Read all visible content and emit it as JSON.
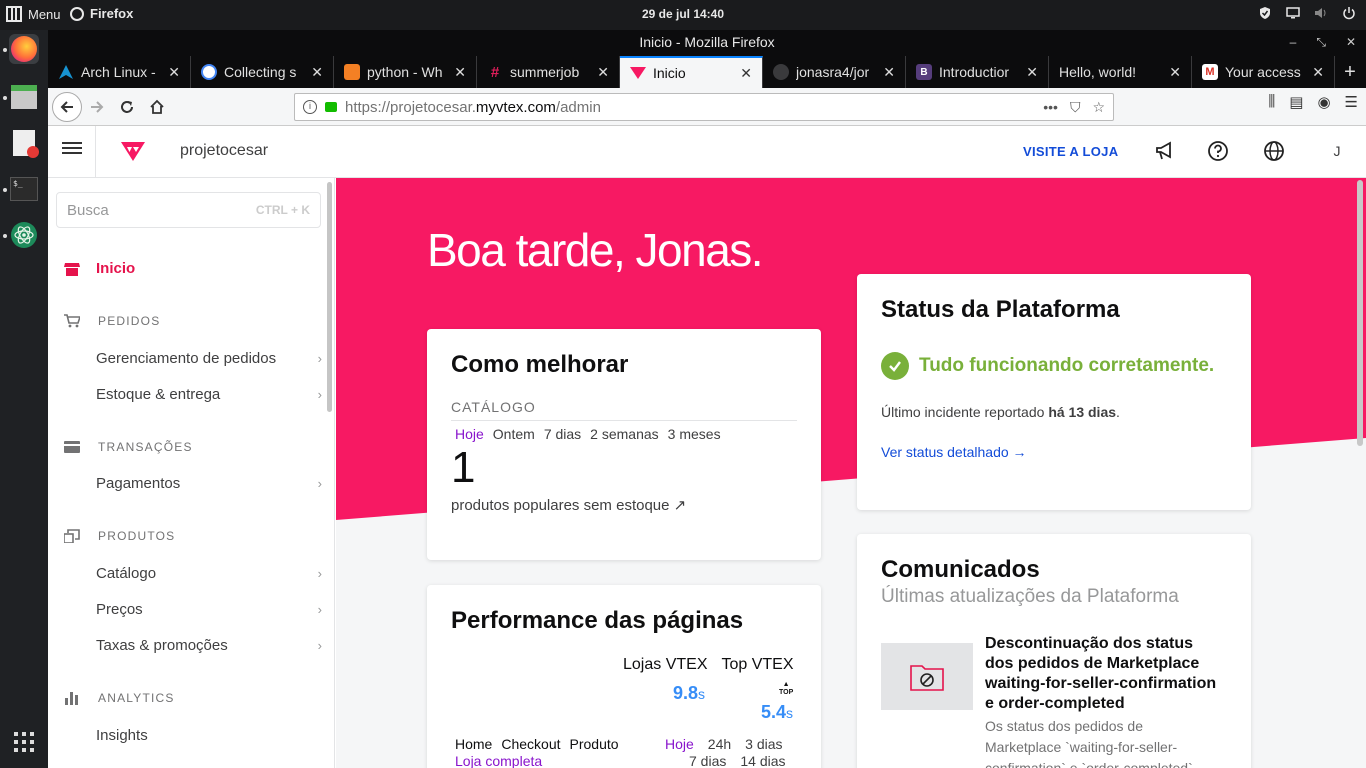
{
  "desktop": {
    "menu_label": "Menu",
    "app_name": "Firefox",
    "clock": "29 de jul  14:40"
  },
  "browser": {
    "window_title": "Inicio - Mozilla Firefox",
    "tabs": [
      {
        "label": "Arch Linux -",
        "favicon": "arch-icon",
        "color": "#1793d1"
      },
      {
        "label": "Collecting s",
        "favicon": "google-icon",
        "color": "#ffffff"
      },
      {
        "label": "python - Wh",
        "favicon": "stackoverflow-icon",
        "color": "#f48024"
      },
      {
        "label": "summerjob",
        "favicon": "slack-icon",
        "color": "#611f69"
      },
      {
        "label": "Inicio",
        "favicon": "vtex-icon",
        "color": "#f71963",
        "active": true
      },
      {
        "label": "jonasra4/jor",
        "favicon": "github-icon",
        "color": "#24292e"
      },
      {
        "label": "Introductior",
        "favicon": "bootstrap-icon",
        "color": "#563d7c"
      },
      {
        "label": "Hello, world!",
        "favicon": "none",
        "color": ""
      },
      {
        "label": "Your access",
        "favicon": "gmail-icon",
        "color": "#d93025"
      }
    ],
    "url_prefix": "https://projetocesar.",
    "url_host": "myvtex.com",
    "url_path": "/admin"
  },
  "admin": {
    "account_name": "projetocesar",
    "visit_store_label": "VISITE A LOJA",
    "avatar_initial": "J",
    "brand_color": "#f71963"
  },
  "sidebar": {
    "search_placeholder": "Busca",
    "search_shortcut": "CTRL + K",
    "home_label": "Inicio",
    "sections": [
      {
        "title": "PEDIDOS",
        "items": [
          "Gerenciamento de pedidos",
          "Estoque & entrega"
        ]
      },
      {
        "title": "TRANSAÇÕES",
        "items": [
          "Pagamentos"
        ]
      },
      {
        "title": "PRODUTOS",
        "items": [
          "Catálogo",
          "Preços",
          "Taxas & promoções"
        ]
      },
      {
        "title": "ANALYTICS",
        "items": [
          "Insights"
        ]
      }
    ]
  },
  "main": {
    "greeting": "Boa tarde, Jonas.",
    "improve_card": {
      "title": "Como melhorar",
      "section": "CATÁLOGO",
      "periods": [
        "Hoje",
        "Ontem",
        "7 dias",
        "2 semanas",
        "3 meses"
      ],
      "selected_period": "Hoje",
      "value": "1",
      "description": "produtos populares sem estoque ↗"
    },
    "performance_card": {
      "title": "Performance das páginas",
      "col1_label": "Lojas VTEX",
      "col2_label": "Top VTEX",
      "col1_value": "9.8",
      "col2_value": "5.4",
      "unit": "s",
      "top_badge": "TOP",
      "page_tabs": [
        "Home",
        "Checkout",
        "Produto"
      ],
      "page_tab2": "Loja completa",
      "time_row1": [
        "Hoje",
        "24h",
        "3 dias"
      ],
      "time_row2": [
        "7 dias",
        "14 dias"
      ]
    },
    "status_card": {
      "title": "Status da Plataforma",
      "status_text": "Tudo funcionando corretamente.",
      "incident_prefix": "Último incidente reportado ",
      "incident_time": "há 13 dias",
      "incident_suffix": ".",
      "link": "Ver status detalhado →"
    },
    "news_card": {
      "title": "Comunicados",
      "subtitle": "Últimas atualizações da Plataforma",
      "item_title": "Descontinuação dos status dos pedidos de Marketplace waiting-for-seller-confirmation e order-completed",
      "item_body": "Os status dos pedidos de Marketplace `waiting-for-seller-confirmation` e `order-completed`"
    }
  }
}
